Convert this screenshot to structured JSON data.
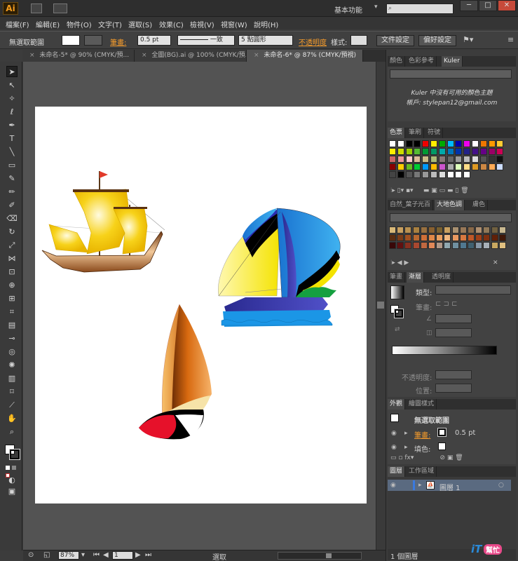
{
  "app": {
    "logo": "Ai",
    "workspace": "基本功能",
    "search_placeholder": "",
    "window_buttons": [
      "─",
      "□",
      "✕"
    ]
  },
  "menu": [
    "檔案(F)",
    "編輯(E)",
    "物件(O)",
    "文字(T)",
    "選取(S)",
    "效果(C)",
    "檢視(V)",
    "視窗(W)",
    "說明(H)"
  ],
  "control": {
    "selection": "無選取範圍",
    "stroke_label": "筆畫:",
    "stroke_value": "0.5 pt",
    "profile": "一致",
    "brush": "5 點圓形",
    "opacity_label": "不透明度",
    "style_label": "樣式:",
    "doc_setup": "文件設定",
    "prefs": "偏好設定"
  },
  "tabs": [
    {
      "label": "未命名-5* @ 90% (CMYK/預...",
      "close": "×"
    },
    {
      "label": "全圖(BG).ai @ 100% (CMYK/預...",
      "close": "×"
    },
    {
      "label": "未命名-6* @ 87% (CMYK/預視)",
      "close": "×"
    }
  ],
  "status": {
    "zoom": "87%",
    "page": "1",
    "mode": "選取"
  },
  "kuler": {
    "tabs": [
      "顏色",
      "色彩參考",
      "Kuler"
    ],
    "message_line1": "Kuler 中沒有可用的顏色主題",
    "message_line2": "帳戶: stylepan12@gmail.com"
  },
  "swatches_panel": {
    "tabs": [
      "色票",
      "筆刷",
      "符號"
    ]
  },
  "earth_panel": {
    "tabs": [
      "自然_葉子",
      "光百",
      "大地色調",
      "膚色"
    ]
  },
  "gradient_panel": {
    "tabs": [
      "筆畫",
      "漸層",
      "透明度"
    ],
    "type_label": "類型:",
    "stroke_label": "筆畫:",
    "opacity_label": "不透明度:",
    "position_label": "位置:"
  },
  "appearance": {
    "tabs": [
      "外觀",
      "繪圖樣式"
    ],
    "title": "無選取範圍",
    "stroke_label": "筆畫:",
    "stroke_value": "0.5 pt",
    "fill_label": "填色:"
  },
  "layers": {
    "tabs": [
      "圖層",
      "工作區域"
    ],
    "layer_name": "圖層 1",
    "count": "1 個圖層"
  },
  "watermark": {
    "text1": "iT",
    "text2": "幫忙"
  },
  "colors": {
    "accent": "#f39a2b",
    "canvas": "#535353",
    "panel": "#424242"
  }
}
